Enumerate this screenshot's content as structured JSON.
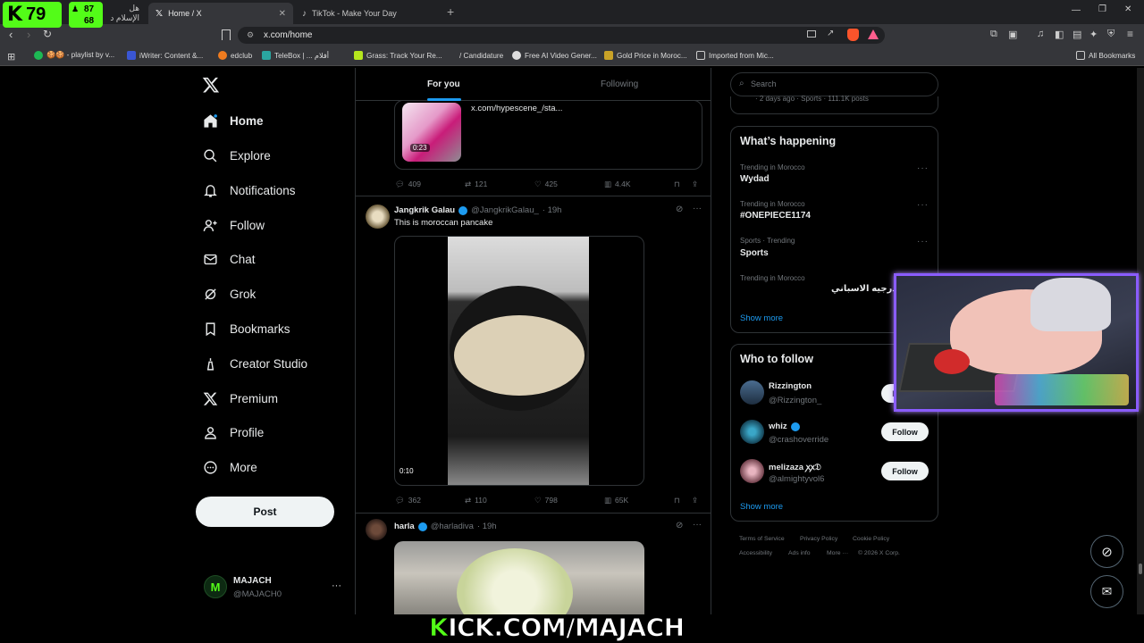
{
  "overlay": {
    "k_badge": "79",
    "stat_top": "87",
    "stat_bottom": "68",
    "kick_banner": "ICK.COM/MAJACH",
    "kick_letter": "K"
  },
  "browser": {
    "tabs": [
      {
        "label": "هل الإسلام د",
        "active": false
      },
      {
        "label": "Home / X",
        "active": true
      },
      {
        "label": "TikTok - Make Your Day",
        "active": false
      }
    ],
    "new_tab": "+",
    "url": "x.com/home",
    "bookmarks": [
      {
        "label": "🍪🍪 - playlist by v..."
      },
      {
        "label": "iWriter: Content &..."
      },
      {
        "label": "edclub"
      },
      {
        "label": "TeleBox | ... أفلام"
      },
      {
        "label": "Grass: Track Your Re..."
      },
      {
        "label": "/ Candidature"
      },
      {
        "label": "Free AI Video Gener..."
      },
      {
        "label": "Gold Price in Moroc..."
      },
      {
        "label": "Imported from Mic..."
      }
    ],
    "all_bookmarks": "All Bookmarks"
  },
  "sidebar": {
    "items": [
      {
        "label": "Home",
        "icon": "home-icon"
      },
      {
        "label": "Explore",
        "icon": "search-icon"
      },
      {
        "label": "Notifications",
        "icon": "bell-icon"
      },
      {
        "label": "Follow",
        "icon": "person-add-icon"
      },
      {
        "label": "Chat",
        "icon": "mail-icon"
      },
      {
        "label": "Grok",
        "icon": "grok-icon"
      },
      {
        "label": "Bookmarks",
        "icon": "bookmark-icon"
      },
      {
        "label": "Creator Studio",
        "icon": "creator-icon"
      },
      {
        "label": "Premium",
        "icon": "x-logo-icon"
      },
      {
        "label": "Profile",
        "icon": "person-icon"
      },
      {
        "label": "More",
        "icon": "more-circle-icon"
      }
    ],
    "post_label": "Post",
    "account": {
      "name": "MAJACH",
      "handle": "@MAJACH0"
    }
  },
  "feed": {
    "tabs": [
      "For you",
      "Following"
    ],
    "posts": [
      {
        "link": "x.com/hypescene_/sta...",
        "duration": "0:23",
        "replies": "409",
        "reposts": "121",
        "likes": "425",
        "views": "4.4K"
      },
      {
        "author": "Jangkrik Galau",
        "handle": "@JangkrikGalau_",
        "time": "· 19h",
        "text": "This is moroccan pancake",
        "duration": "0:10",
        "replies": "362",
        "reposts": "110",
        "likes": "798",
        "views": "65K"
      },
      {
        "author": "harla",
        "handle": "@harladiva",
        "time": "· 19h"
      }
    ]
  },
  "right": {
    "search_placeholder": "Search",
    "top_snippet": "· 2 days ago · Sports · 111.1K posts",
    "whats_happening": "What’s happening",
    "trends": [
      {
        "meta": "Trending in Morocco",
        "title": "Wydad"
      },
      {
        "meta": "Trending in Morocco",
        "title": "#ONEPIECE1174"
      },
      {
        "meta": "Sports · Trending",
        "title": "Sports"
      },
      {
        "meta": "Trending in Morocco",
        "title": "و ✕ الدرجيه الاسباني"
      }
    ],
    "show_more": "Show more",
    "who_to_follow": "Who to follow",
    "who": [
      {
        "name": "Rizzington",
        "handle": "@Rizzington_",
        "button": "Follow"
      },
      {
        "name": "whiz",
        "handle": "@crashoverride",
        "button": "Follow"
      },
      {
        "name": "melizaza ꭗꭗ𝔇",
        "handle": "@almightyvol6",
        "button": "Follow"
      }
    ],
    "footer": [
      "Terms of Service",
      "Privacy Policy",
      "Cookie Policy",
      "Accessibility",
      "Ads info",
      "More ···",
      "© 2026 X Corp."
    ]
  },
  "colors": {
    "accent": "#1d9bf0",
    "kick_green": "#53fc18",
    "webcam_border": "#8a5cff"
  }
}
